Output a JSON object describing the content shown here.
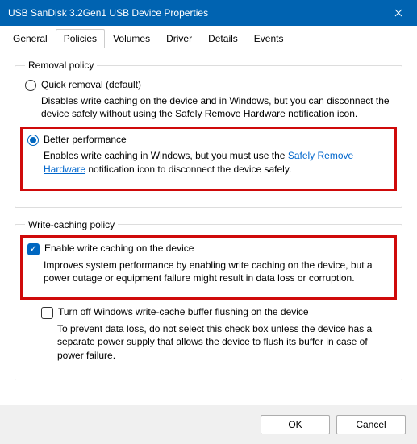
{
  "title": "USB  SanDisk 3.2Gen1 USB Device Properties",
  "tabs": [
    "General",
    "Policies",
    "Volumes",
    "Driver",
    "Details",
    "Events"
  ],
  "activeTab": 1,
  "removalPolicy": {
    "legend": "Removal policy",
    "quick": {
      "label": "Quick removal (default)",
      "desc": "Disables write caching on the device and in Windows, but you can disconnect the device safely without using the Safely Remove Hardware notification icon."
    },
    "better": {
      "label": "Better performance",
      "descPrefix": "Enables write caching in Windows, but you must use the ",
      "link": "Safely Remove Hardware",
      "descSuffix": " notification icon to disconnect the device safely."
    }
  },
  "writeCaching": {
    "legend": "Write-caching policy",
    "enable": {
      "label": "Enable write caching on the device",
      "desc": "Improves system performance by enabling write caching on the device, but a power outage or equipment failure might result in data loss or corruption."
    },
    "turnoff": {
      "label": "Turn off Windows write-cache buffer flushing on the device",
      "desc": "To prevent data loss, do not select this check box unless the device has a separate power supply that allows the device to flush its buffer in case of power failure."
    }
  },
  "buttons": {
    "ok": "OK",
    "cancel": "Cancel"
  }
}
